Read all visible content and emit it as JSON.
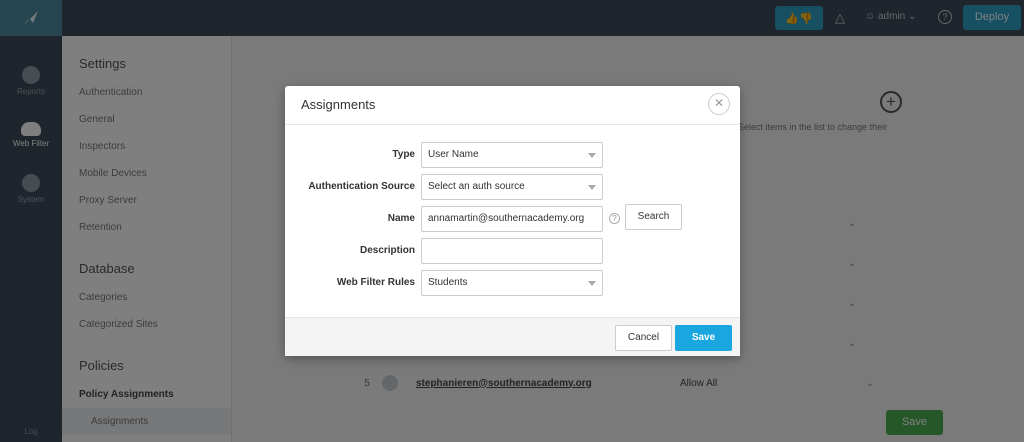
{
  "rail": {
    "items": [
      {
        "label": "Reports",
        "icon": "pie-chart-icon"
      },
      {
        "label": "Web Filter",
        "icon": "cloud-icon"
      },
      {
        "label": "System",
        "icon": "gear-icon"
      }
    ],
    "bottom_label": "Log"
  },
  "topbar": {
    "thumbs_icon": "thumbs-icon",
    "user_label": "admin",
    "deploy_label": "Deploy"
  },
  "sidebar": {
    "settings_heading": "Settings",
    "settings_items": [
      "Authentication",
      "General",
      "Inspectors",
      "Mobile Devices",
      "Proxy Server",
      "Retention"
    ],
    "database_heading": "Database",
    "database_items": [
      "Categories",
      "Categorized Sites"
    ],
    "policies_heading": "Policies",
    "policy_assignments": "Policy Assignments",
    "assignments": "Assignments"
  },
  "background": {
    "hint": "Select items in the list to change their",
    "row": {
      "num": "5",
      "email": "stephanieren@southernacademy.org",
      "policy": "Allow All"
    },
    "save_label": "Save"
  },
  "modal": {
    "title": "Assignments",
    "fields": {
      "type_label": "Type",
      "type_value": "User Name",
      "auth_label": "Authentication Source",
      "auth_value": "Select an auth source",
      "name_label": "Name",
      "name_value": "annamartin@southernacademy.org",
      "desc_label": "Description",
      "desc_value": "",
      "rules_label": "Web Filter Rules",
      "rules_value": "Students"
    },
    "search_label": "Search",
    "cancel_label": "Cancel",
    "save_label": "Save"
  },
  "colors": {
    "accent": "#1aa7e0",
    "rail": "#3c4b58",
    "green": "#4caf50"
  }
}
